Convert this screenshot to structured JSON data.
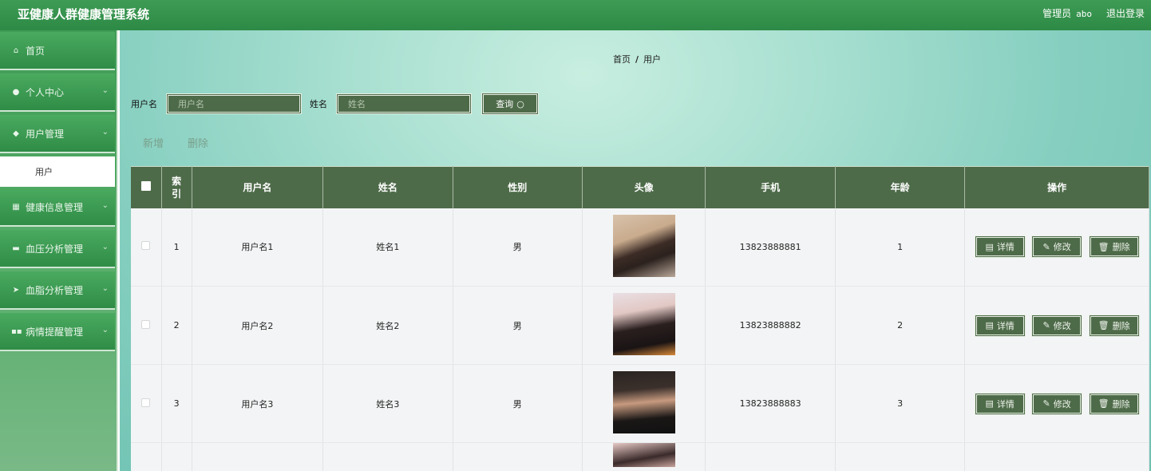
{
  "header": {
    "title": "亚健康人群健康管理系统",
    "user_role": "管理员",
    "user_name": "abo",
    "logout": "退出登录"
  },
  "sidebar": {
    "items": [
      {
        "label": "首页",
        "icon": "home-icon"
      },
      {
        "label": "个人中心",
        "icon": "person-icon"
      },
      {
        "label": "用户管理",
        "icon": "users-icon",
        "sub": "用户"
      },
      {
        "label": "健康信息管理",
        "icon": "grid-icon"
      },
      {
        "label": "血压分析管理",
        "icon": "chart-icon"
      },
      {
        "label": "血脂分析管理",
        "icon": "send-icon"
      },
      {
        "label": "病情提醒管理",
        "icon": "apps-icon"
      }
    ]
  },
  "breadcrumb": {
    "home": "首页",
    "sep": "/",
    "current": "用户"
  },
  "search": {
    "username_label": "用户名",
    "username_placeholder": "用户名",
    "name_label": "姓名",
    "name_placeholder": "姓名",
    "query_button": "查询"
  },
  "actions": {
    "add": "新增",
    "delete": "删除"
  },
  "table": {
    "columns": [
      "索引",
      "用户名",
      "姓名",
      "性别",
      "头像",
      "手机",
      "年龄",
      "操作"
    ],
    "rows": [
      {
        "index": "1",
        "username": "用户名1",
        "name": "姓名1",
        "gender": "男",
        "phone": "13823888881",
        "age": "1"
      },
      {
        "index": "2",
        "username": "用户名2",
        "name": "姓名2",
        "gender": "男",
        "phone": "13823888882",
        "age": "2"
      },
      {
        "index": "3",
        "username": "用户名3",
        "name": "姓名3",
        "gender": "男",
        "phone": "13823888883",
        "age": "3"
      }
    ],
    "ops": {
      "detail": "详情",
      "edit": "修改",
      "delete": "删除"
    }
  }
}
